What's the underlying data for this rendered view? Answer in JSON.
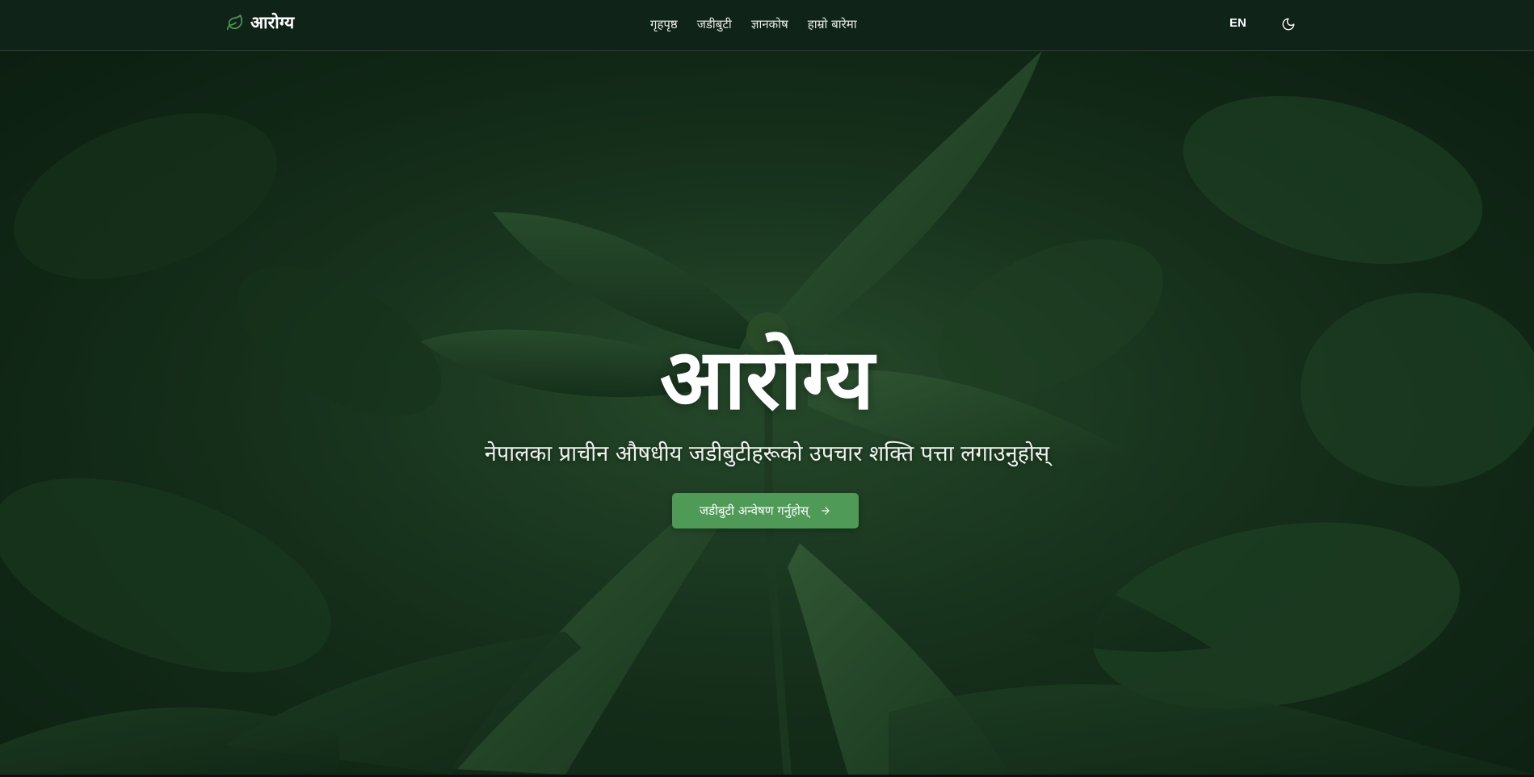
{
  "header": {
    "brand": "आरोग्य",
    "brand_icon": "leaf-icon",
    "nav": [
      {
        "label": "गृहपृष्ठ"
      },
      {
        "label": "जडीबुटी"
      },
      {
        "label": "ज्ञानकोष"
      },
      {
        "label": "हाम्रो बारेमा"
      }
    ],
    "language": "EN",
    "theme_icon": "moon-icon"
  },
  "hero": {
    "title": "आरोग्य",
    "subtitle": "नेपालका प्राचीन औषधीय जडीबुटीहरूको उपचार शक्ति पत्ता लगाउनुहोस्",
    "cta_label": "जडीबुटी अन्वेषण गर्नुहोस्",
    "cta_icon": "arrow-right-icon"
  },
  "colors": {
    "accent": "#4f9a57",
    "header_bg": "#0f2318",
    "hero_bg": "#1d3d24"
  }
}
